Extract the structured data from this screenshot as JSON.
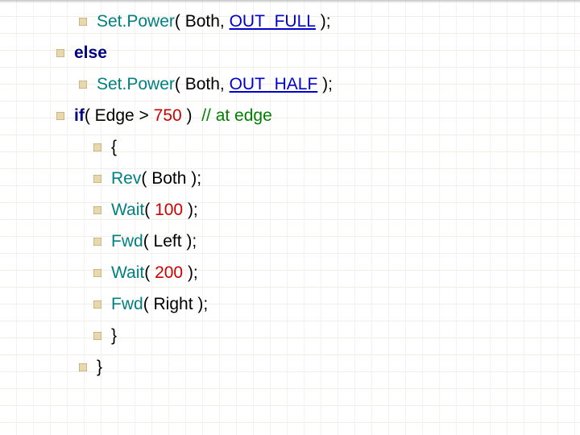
{
  "lines": {
    "l1": {
      "fn": "Set.Power",
      "open": "( ",
      "arg1": "Both, ",
      "const": "OUT_FULL",
      "close": " );"
    },
    "l2": {
      "kw": "else"
    },
    "l3": {
      "fn": "Set.Power",
      "open": "( ",
      "arg1": "Both, ",
      "const": "OUT_HALF",
      "close": " );"
    },
    "l4": {
      "kw": "if",
      "open": "( ",
      "var": "Edge > ",
      "num": "750",
      "close": " )  ",
      "cmt": "// at edge"
    },
    "l5": {
      "txt": "{"
    },
    "l6": {
      "fn": "Rev",
      "open": "( ",
      "arg": "Both",
      "close": " );"
    },
    "l7": {
      "fn": "Wait",
      "open": "( ",
      "num": "100",
      "close": " );"
    },
    "l8": {
      "fn": "Fwd",
      "open": "( ",
      "arg": "Left",
      "close": " );"
    },
    "l9": {
      "fn": "Wait",
      "open": "( ",
      "num": "200",
      "close": " );"
    },
    "l10": {
      "fn": "Fwd",
      "open": "( ",
      "arg": "Right",
      "close": " );"
    },
    "l11": {
      "txt": "}"
    },
    "l12": {
      "txt": "}"
    }
  }
}
